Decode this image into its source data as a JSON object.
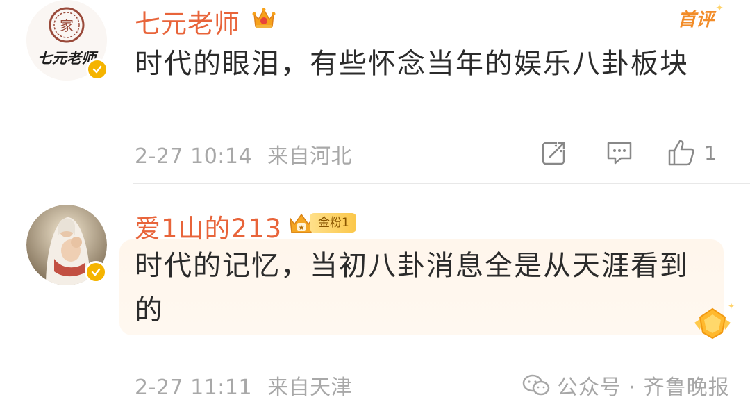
{
  "comments": [
    {
      "username": "七元老师",
      "first_tag": "首评",
      "content": "时代的眼泪，有些怀念当年的娱乐八卦板块",
      "time": "2-27 10:14",
      "location": "来自河北",
      "like_count": "1",
      "avatar_text": "七元老师"
    },
    {
      "username": "爱1山的213",
      "fan_badge": "金粉1",
      "content": "时代的记忆，当初八卦消息全是从天涯看到的",
      "time": "2-27 11:11",
      "location": "来自天津"
    }
  ],
  "watermark": {
    "text": "公众号 · 齐鲁晚报"
  },
  "colors": {
    "username": "#e8643a",
    "meta": "#a8a8a8",
    "verified": "#f5b400",
    "highlight": "#fff6ec"
  },
  "icons": [
    "crown-icon",
    "verified-icon",
    "repost-icon",
    "comment-icon",
    "like-icon",
    "medal-icon",
    "wechat-icon"
  ]
}
